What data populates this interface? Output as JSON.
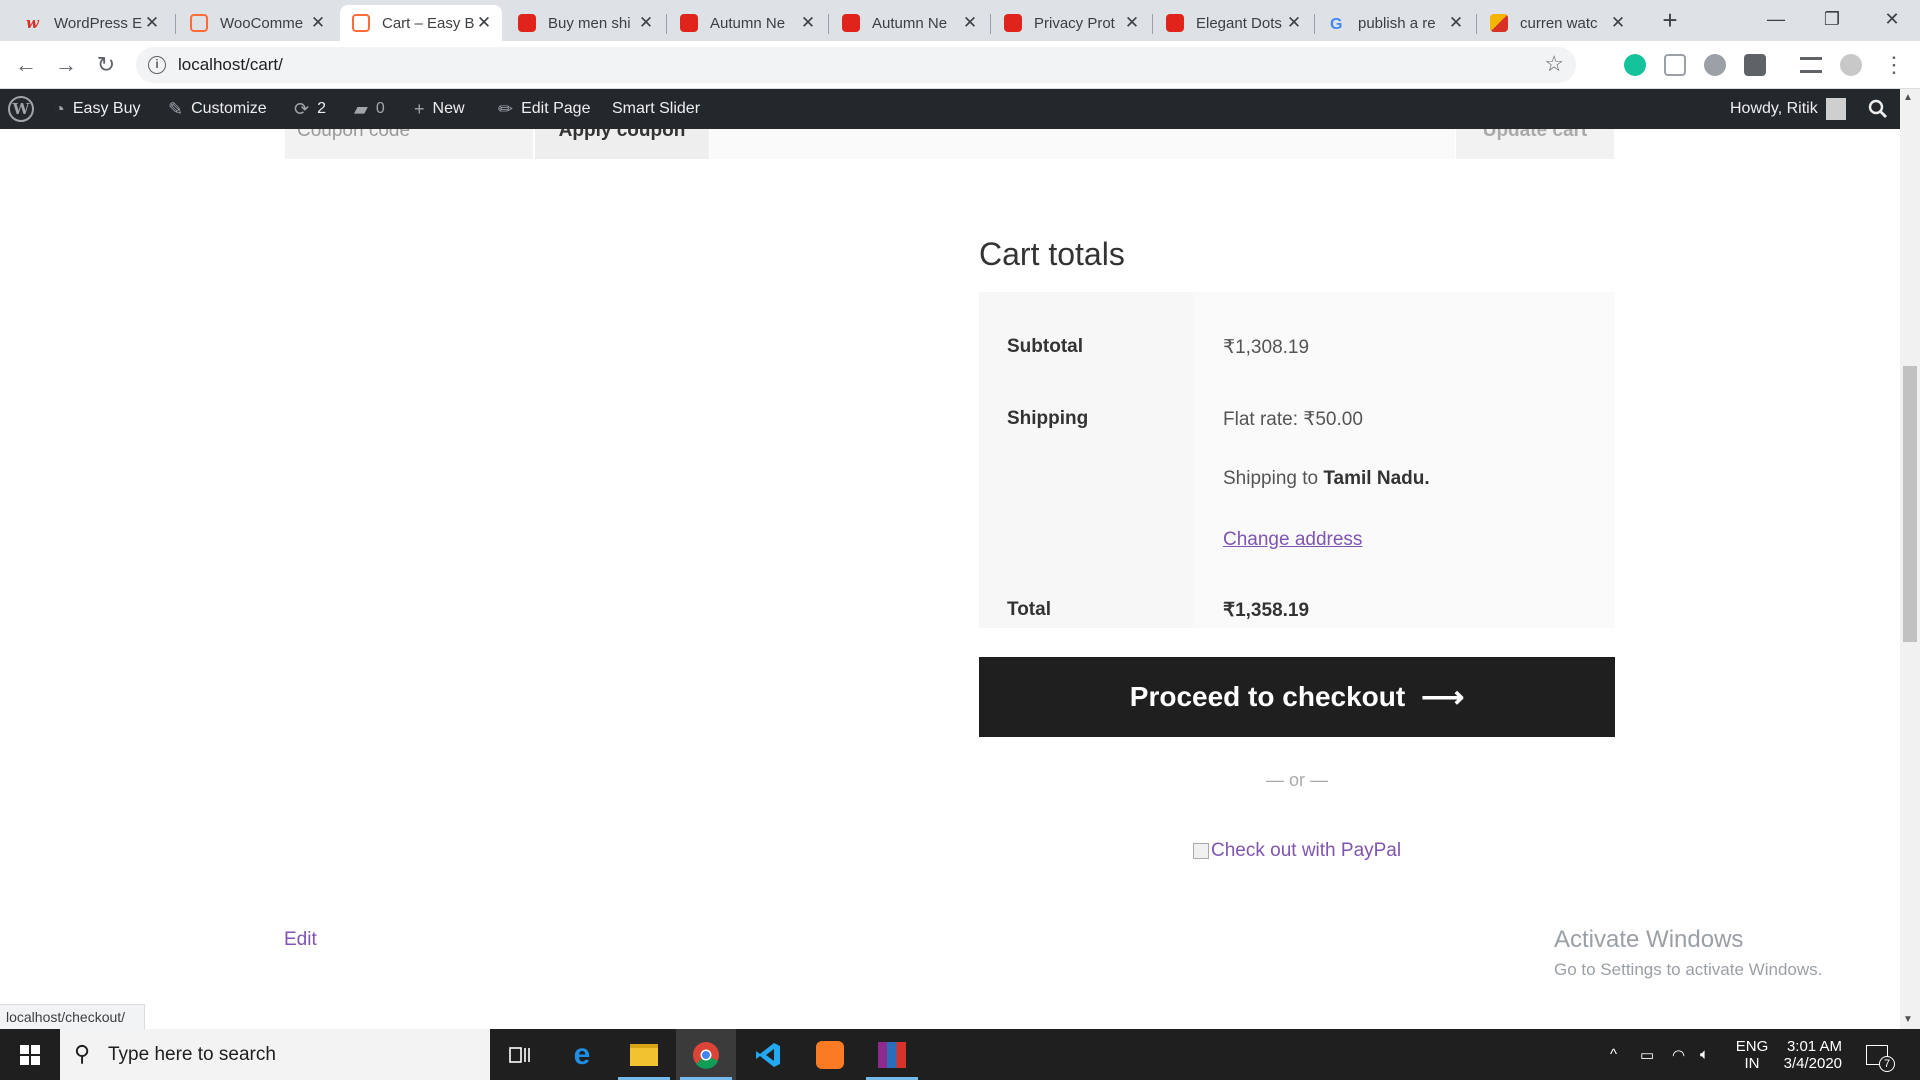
{
  "browser": {
    "tabs": [
      {
        "title": "WordPress E",
        "favicon_color": "#d93025",
        "favicon_glyph": "w",
        "active": false
      },
      {
        "title": "WooComme",
        "favicon_color": "#ff6c37",
        "favicon_glyph": "xampp",
        "active": false
      },
      {
        "title": "Cart – Easy B",
        "favicon_color": "#ff6c37",
        "favicon_glyph": "xampp",
        "active": true
      },
      {
        "title": "Buy men shi",
        "favicon_color": "#e0241b",
        "favicon_glyph": "bag",
        "active": false
      },
      {
        "title": "Autumn Ne",
        "favicon_color": "#e0241b",
        "favicon_glyph": "bag",
        "active": false
      },
      {
        "title": "Autumn Ne",
        "favicon_color": "#e0241b",
        "favicon_glyph": "bag",
        "active": false
      },
      {
        "title": "Privacy Prot",
        "favicon_color": "#e0241b",
        "favicon_glyph": "bag",
        "active": false
      },
      {
        "title": "Elegant Dots",
        "favicon_color": "#e0241b",
        "favicon_glyph": "bag",
        "active": false
      },
      {
        "title": "publish a re",
        "favicon_color": "#4285f4",
        "favicon_glyph": "G",
        "active": false
      },
      {
        "title": "curren watc",
        "favicon_color": "#f4b400",
        "favicon_glyph": "flag",
        "active": false
      }
    ],
    "tab_close_glyph": "✕",
    "new_tab_glyph": "+",
    "window_controls": {
      "minimize": "—",
      "maximize": "❐",
      "close": "✕"
    },
    "url": "localhost/cart/",
    "status_url": "localhost/checkout/"
  },
  "adminbar": {
    "site_name": "Easy Buy",
    "customize": "Customize",
    "updates_count": "2",
    "comments_count": "0",
    "new_label": "New",
    "edit_page": "Edit Page",
    "smart_slider": "Smart Slider",
    "howdy": "Howdy, Ritik"
  },
  "coupon": {
    "placeholder": "Coupon code",
    "apply_label": "Apply coupon",
    "update_label": "Update cart"
  },
  "cart_totals": {
    "heading": "Cart totals",
    "subtotal_label": "Subtotal",
    "subtotal_value": "₹1,308.19",
    "shipping_label": "Shipping",
    "shipping_rate": "Flat rate: ₹50.00",
    "shipping_to_prefix": "Shipping to ",
    "shipping_to_place": "Tamil Nadu.",
    "change_address": "Change address",
    "total_label": "Total",
    "total_value": "₹1,358.19"
  },
  "checkout": {
    "button_label": "Proceed to checkout",
    "arrow": "⟶",
    "or_separator": "— or —",
    "paypal_alt": "Check out with PayPal"
  },
  "edit_link": "Edit",
  "watermark": {
    "title": "Activate Windows",
    "subtitle": "Go to Settings to activate Windows."
  },
  "taskbar": {
    "search_placeholder": "Type here to search",
    "language_top": "ENG",
    "language_bottom": "IN",
    "time": "3:01 AM",
    "date": "3/4/2020",
    "notification_count": "7"
  },
  "colors": {
    "accent_link": "#7f54b3",
    "checkout_button": "#1f1f1f",
    "adminbar": "#23282d"
  }
}
